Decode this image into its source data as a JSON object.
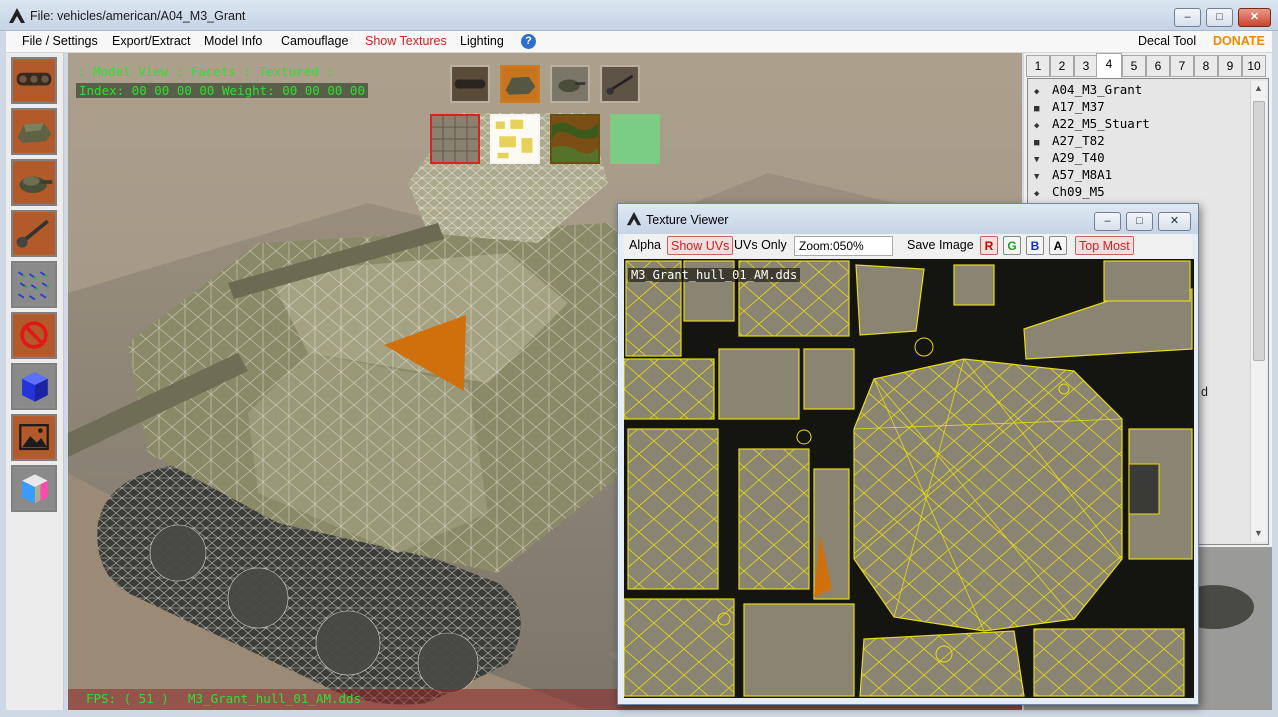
{
  "window": {
    "title": "File: vehicles/american/A04_M3_Grant",
    "minimize_label": "–",
    "maximize_label": "□",
    "close_label": "✕"
  },
  "menu": {
    "items": [
      "File / Settings",
      "Export/Extract",
      "Model Info",
      "Camouflage",
      "Show Textures",
      "Lighting"
    ],
    "active": "Show Textures",
    "help_label": "?",
    "decal_tool": "Decal Tool",
    "donate": "DONATE"
  },
  "left_toolbar": {
    "tools": [
      "tank-track-icon",
      "tank-hull-icon",
      "tank-turret-icon",
      "tank-gun-icon",
      "normals-icon",
      "hide-icon",
      "cube-icon",
      "image-icon",
      "color-cube-icon"
    ]
  },
  "viewport": {
    "mode_label": ": Model View : Facets : Textured :",
    "index_label": "Index: 00 00 00 00 Weight: 00 00 00 00",
    "fps_label": "FPS: ( 51 )",
    "texture_name": "M3_Grant_hull_01_AM.dds",
    "model_thumbs": [
      "track-thumb",
      "hull-thumb",
      "turret-thumb",
      "gun-thumb"
    ],
    "texture_thumbs": [
      "hull-texture-thumb",
      "uv-sheet-thumb",
      "camo-texture-thumb",
      "green-texture-thumb"
    ]
  },
  "tabs": {
    "labels": [
      "1",
      "2",
      "3",
      "4",
      "5",
      "6",
      "7",
      "8",
      "9",
      "10"
    ],
    "selected": "4"
  },
  "vehicle_list": [
    {
      "name": "A04_M3_Grant",
      "marker": "◆"
    },
    {
      "name": "A17_M37",
      "marker": "■"
    },
    {
      "name": "A22_M5_Stuart",
      "marker": "◆"
    },
    {
      "name": "A27_T82",
      "marker": "■"
    },
    {
      "name": "A29_T40",
      "marker": "▼"
    },
    {
      "name": "A57_M8A1",
      "marker": "▼"
    },
    {
      "name": "Ch09_M5",
      "marker": "◆"
    }
  ],
  "texture_viewer": {
    "title": "Texture Viewer",
    "alpha": "Alpha",
    "show_uvs": "Show UVs",
    "uvs_only": "UVs Only",
    "zoom": "Zoom:050%",
    "save_image": "Save Image",
    "channels": [
      {
        "label": "R",
        "color": "#d00000"
      },
      {
        "label": "G",
        "color": "#20a020"
      },
      {
        "label": "B",
        "color": "#1030c0"
      },
      {
        "label": "A",
        "color": "#000000"
      }
    ],
    "top_most": "Top Most",
    "texture_name": "M3_Grant_hull_01_AM.dds"
  },
  "colors": {
    "accent_red": "#d42020",
    "donate_orange": "#f08a00",
    "overlay_green": "#2ee02e",
    "selected_face": "#d0700c",
    "uv_yellow": "#e6dc14"
  }
}
